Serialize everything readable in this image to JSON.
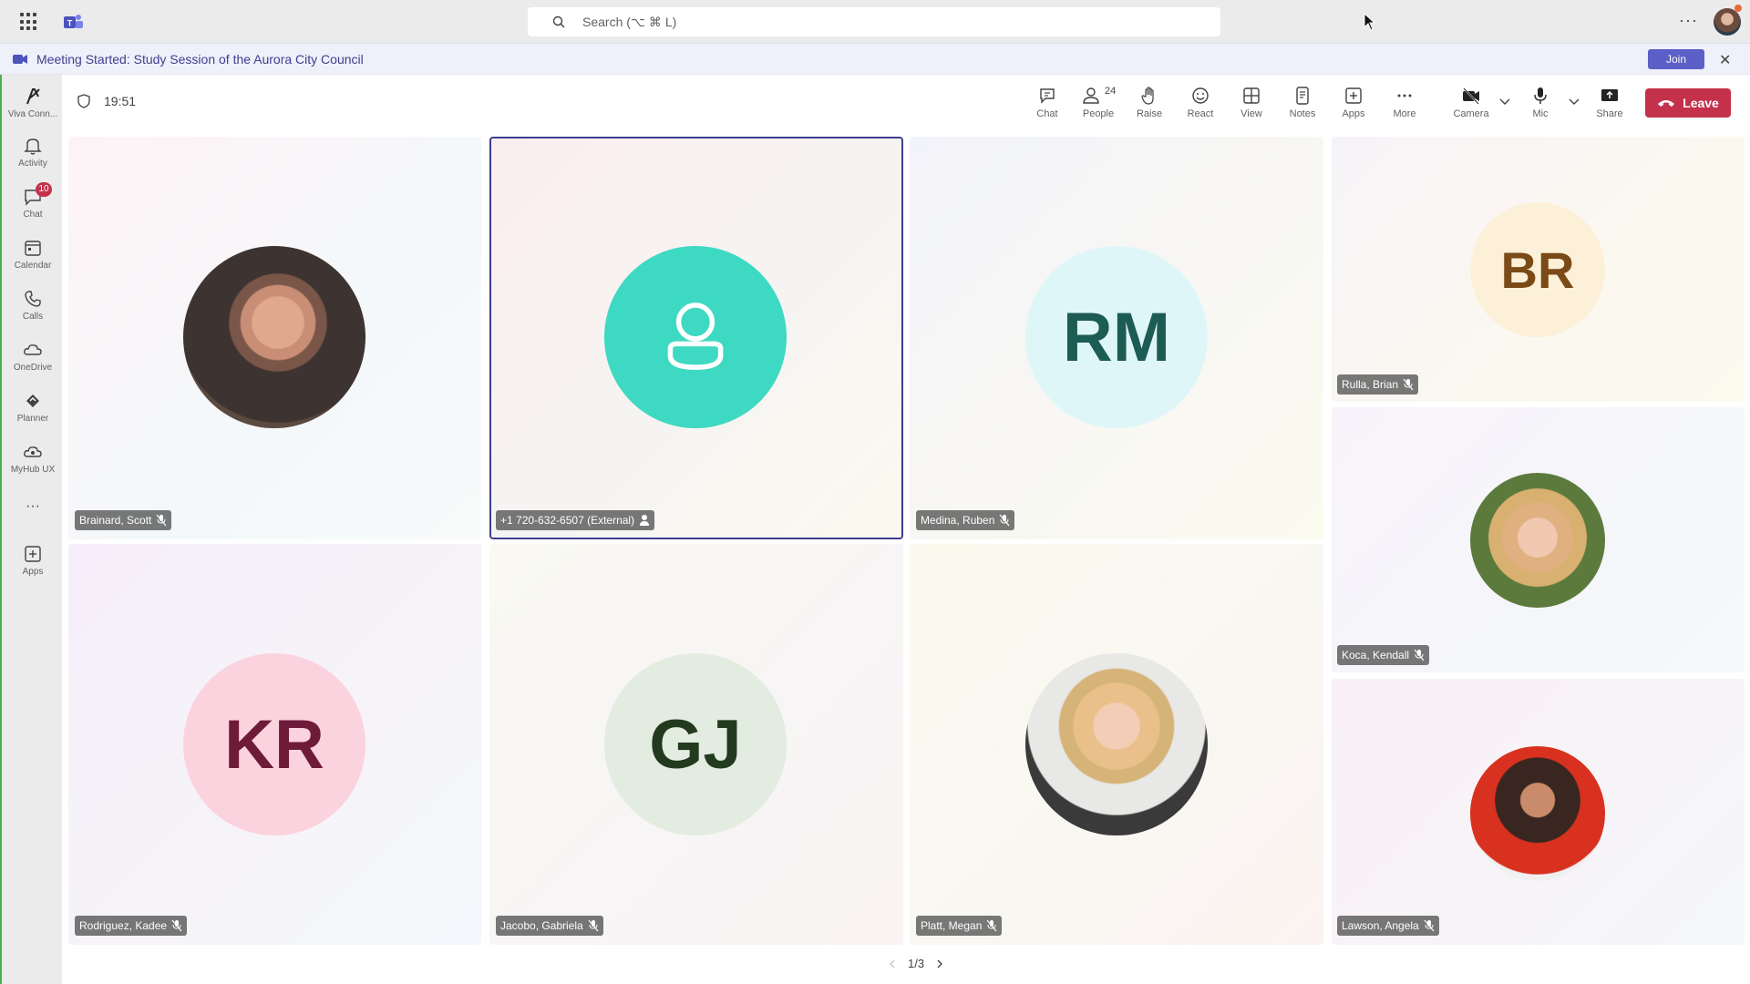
{
  "topbar": {
    "search_placeholder": "Search (⌥ ⌘ L)"
  },
  "banner": {
    "text": "Meeting Started: Study Session of the Aurora City Council",
    "join_label": "Join"
  },
  "rail": {
    "items": [
      {
        "label": "Viva Conn...",
        "icon": "viva-icon"
      },
      {
        "label": "Activity",
        "icon": "bell-icon"
      },
      {
        "label": "Chat",
        "icon": "chat-icon",
        "badge": "10"
      },
      {
        "label": "Calendar",
        "icon": "calendar-icon"
      },
      {
        "label": "Calls",
        "icon": "phone-icon"
      },
      {
        "label": "OneDrive",
        "icon": "cloud-icon"
      },
      {
        "label": "Planner",
        "icon": "planner-icon"
      },
      {
        "label": "MyHub UX",
        "icon": "hub-icon"
      },
      {
        "label": "",
        "icon": "more-icon"
      },
      {
        "label": "Apps",
        "icon": "add-apps-icon"
      }
    ]
  },
  "meeting": {
    "timer": "19:51",
    "toolbar": {
      "chat": "Chat",
      "people": "People",
      "people_count": "24",
      "raise": "Raise",
      "react": "React",
      "view": "View",
      "notes": "Notes",
      "apps": "Apps",
      "more": "More",
      "camera": "Camera",
      "mic": "Mic",
      "share": "Share",
      "leave": "Leave"
    },
    "participants": [
      {
        "name": "Brainard, Scott",
        "initials": "",
        "photo": true
      },
      {
        "name": "+1 720-632-6507 (External)",
        "initials": "",
        "photo": false
      },
      {
        "name": "Medina, Ruben",
        "initials": "RM",
        "photo": false
      },
      {
        "name": "Rulla, Brian",
        "initials": "BR",
        "photo": false
      },
      {
        "name": "Koca, Kendall",
        "initials": "",
        "photo": true
      },
      {
        "name": "Rodriguez, Kadee",
        "initials": "KR",
        "photo": false
      },
      {
        "name": "Jacobo, Gabriela",
        "initials": "GJ",
        "photo": false
      },
      {
        "name": "Platt, Megan",
        "initials": "",
        "photo": true
      },
      {
        "name": "Lawson, Angela",
        "initials": "",
        "photo": true
      }
    ],
    "pager": "1/3"
  },
  "colors": {
    "accent": "#5b5fc7",
    "leave": "#c4314b",
    "badge": "#c4314b",
    "external_avatar": "#3ed9c2",
    "rm_avatar": "#dff6f8",
    "br_avatar": "#fdf0d8",
    "kr_avatar": "#fbd3de",
    "gj_avatar": "#e3ece0"
  }
}
